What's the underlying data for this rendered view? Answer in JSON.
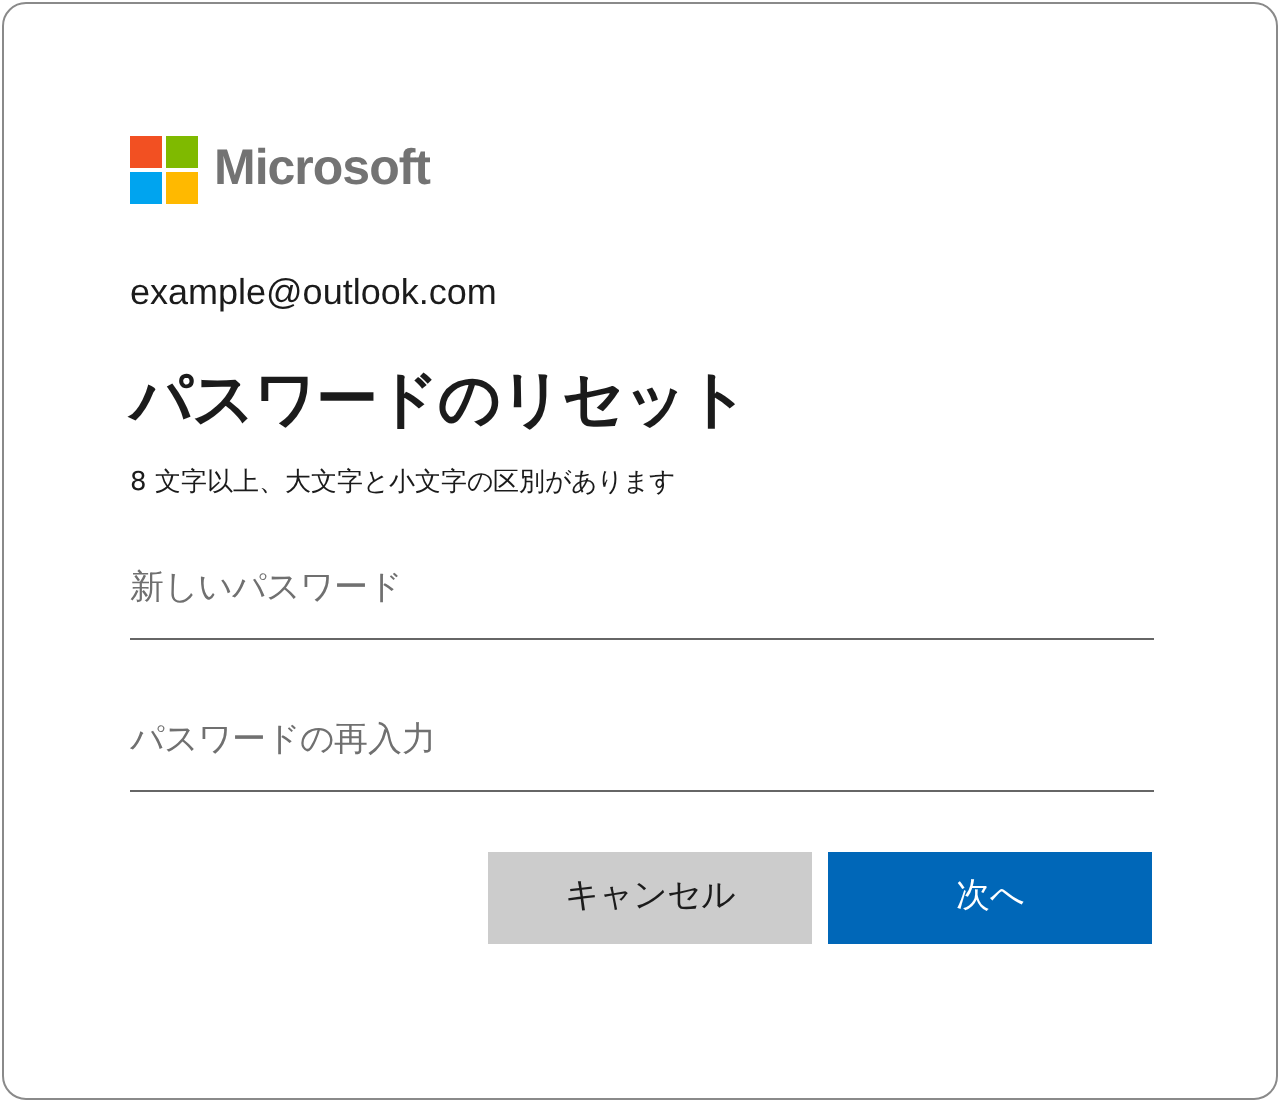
{
  "logo": {
    "text": "Microsoft"
  },
  "account": "example@outlook.com",
  "title": "パスワードのリセット",
  "description": "8 文字以上、大文字と小文字の区別があります",
  "fields": [
    {
      "placeholder": "新しいパスワード"
    },
    {
      "placeholder": "パスワードの再入力"
    }
  ],
  "buttons": [
    {
      "label": "キャンセル",
      "kind": "secondary"
    },
    {
      "label": "次へ",
      "kind": "primary"
    }
  ]
}
